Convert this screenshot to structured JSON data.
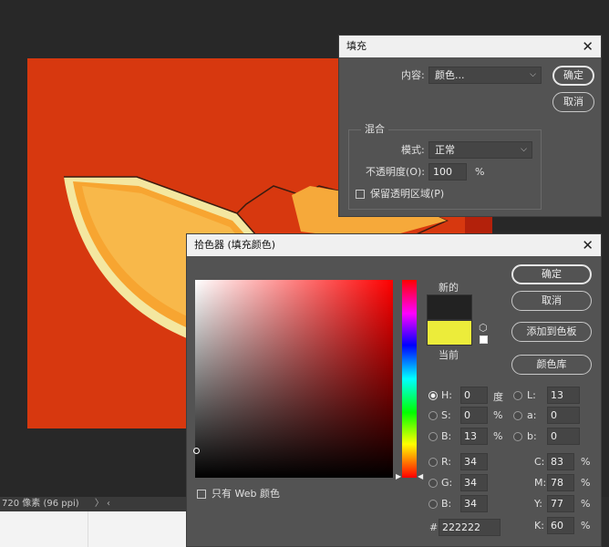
{
  "statusbar": {
    "doc_info": "720 像素 (96 ppi)",
    "nav": "〉 ‹"
  },
  "fill_dialog": {
    "title": "填充",
    "content_label": "内容:",
    "content_value": "颜色...",
    "ok": "确定",
    "cancel": "取消",
    "blend_legend": "混合",
    "mode_label": "模式:",
    "mode_value": "正常",
    "opacity_label": "不透明度(O):",
    "opacity_value": "100",
    "opacity_unit": "%",
    "preserve_label": "保留透明区域(P)"
  },
  "picker": {
    "title": "拾色器 (填充颜色)",
    "ok": "确定",
    "cancel": "取消",
    "add_swatch": "添加到色板",
    "libraries": "颜色库",
    "new_label": "新的",
    "current_label": "当前",
    "new_color": "#222222",
    "current_color": "#ecec3a",
    "web_only": "只有 Web 颜色",
    "hex_hash": "#",
    "hex_value": "222222",
    "hsb": [
      {
        "label": "H:",
        "value": "0",
        "unit": "度"
      },
      {
        "label": "S:",
        "value": "0",
        "unit": "%"
      },
      {
        "label": "B:",
        "value": "13",
        "unit": "%"
      }
    ],
    "rgb": [
      {
        "label": "R:",
        "value": "34"
      },
      {
        "label": "G:",
        "value": "34"
      },
      {
        "label": "B:",
        "value": "34"
      }
    ],
    "lab": [
      {
        "label": "L:",
        "value": "13"
      },
      {
        "label": "a:",
        "value": "0"
      },
      {
        "label": "b:",
        "value": "0"
      }
    ],
    "cmyk": [
      {
        "label": "C:",
        "value": "83",
        "unit": "%"
      },
      {
        "label": "M:",
        "value": "78",
        "unit": "%"
      },
      {
        "label": "Y:",
        "value": "77",
        "unit": "%"
      },
      {
        "label": "K:",
        "value": "60",
        "unit": "%"
      }
    ],
    "hue_color": "#ff0000"
  },
  "icons": {
    "close": "close-icon",
    "gamut": "cube-warning-icon",
    "websafe": "websafe-square-icon"
  }
}
